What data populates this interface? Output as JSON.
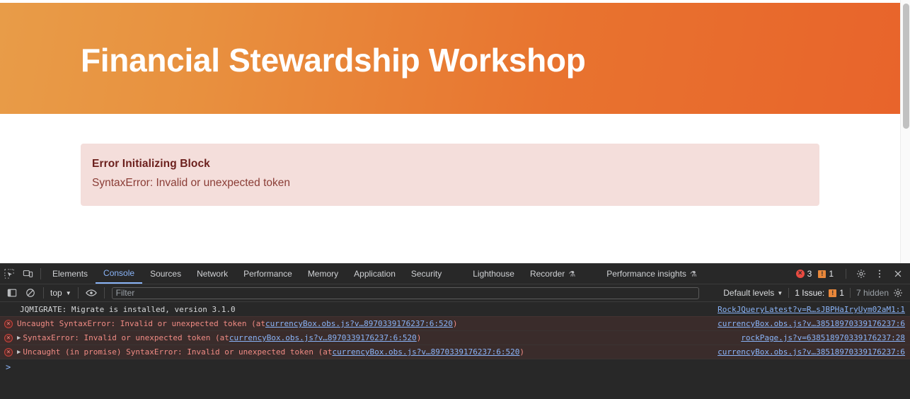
{
  "page": {
    "hero": {
      "title": "Financial Stewardship Workshop"
    },
    "error_callout": {
      "title": "Error Initializing Block",
      "message": "SyntaxError: Invalid or unexpected token"
    }
  },
  "devtools": {
    "tabs": [
      {
        "label": "Elements",
        "active": false,
        "flask": ""
      },
      {
        "label": "Console",
        "active": true,
        "flask": ""
      },
      {
        "label": "Sources",
        "active": false,
        "flask": ""
      },
      {
        "label": "Network",
        "active": false,
        "flask": ""
      },
      {
        "label": "Performance",
        "active": false,
        "flask": ""
      },
      {
        "label": "Memory",
        "active": false,
        "flask": ""
      },
      {
        "label": "Application",
        "active": false,
        "flask": ""
      },
      {
        "label": "Security",
        "active": false,
        "flask": ""
      },
      {
        "label": "Lighthouse",
        "active": false,
        "flask": ""
      },
      {
        "label": "Recorder",
        "active": false,
        "flask": "⚗"
      },
      {
        "label": "Performance insights",
        "active": false,
        "flask": "⚗"
      }
    ],
    "status": {
      "error_count": "3",
      "warning_count": "1"
    },
    "icons": {
      "inspect": "inspect-element-icon",
      "device": "device-toolbar-icon",
      "settings": "gear-icon",
      "more": "more-options-icon",
      "close": "close-icon",
      "sidebar": "console-sidebar-icon",
      "clear": "clear-console-icon",
      "eye": "live-expression-icon",
      "console_settings": "console-settings-gear-icon"
    },
    "filterbar": {
      "context": "top",
      "filter_placeholder": "Filter",
      "filter_value": "",
      "levels": "Default levels",
      "issues_label": "1 Issue:",
      "issues_count": "1",
      "hidden": "7 hidden"
    },
    "messages": [
      {
        "kind": "info",
        "expandable": false,
        "text": "JQMIGRATE: Migrate is installed, version 3.1.0",
        "link_text": "",
        "suffix": "",
        "source": "RockJQueryLatest?v=R…sJBPHaIryUym02aM1:1"
      },
      {
        "kind": "error",
        "expandable": false,
        "text": "Uncaught SyntaxError: Invalid or unexpected token (at ",
        "link_text": "currencyBox.obs.js?v…8970339176237:6:520",
        "suffix": ")",
        "source": "currencyBox.obs.js?v…38518970339176237:6"
      },
      {
        "kind": "error",
        "expandable": true,
        "text": "SyntaxError: Invalid or unexpected token (at ",
        "link_text": "currencyBox.obs.js?v…8970339176237:6:520",
        "suffix": ")",
        "source": "rockPage.js?v=638518970339176237:28"
      },
      {
        "kind": "error",
        "expandable": true,
        "text": "Uncaught (in promise) SyntaxError: Invalid or unexpected token (at ",
        "link_text": "currencyBox.obs.js?v…8970339176237:6:520",
        "suffix": ")",
        "source": "currencyBox.obs.js?v…38518970339176237:6"
      }
    ],
    "prompt": ">"
  },
  "colors": {
    "hero_gradient_start": "#e89c48",
    "hero_gradient_end": "#e8642b",
    "callout_bg": "#f4dedb",
    "callout_title": "#6b1f1c",
    "callout_text": "#8a3d36",
    "devtools_bg": "#282828",
    "error_row_bg": "#3a2c2b",
    "link": "#8ab4f8",
    "active_tab": "#8ab4f8"
  }
}
